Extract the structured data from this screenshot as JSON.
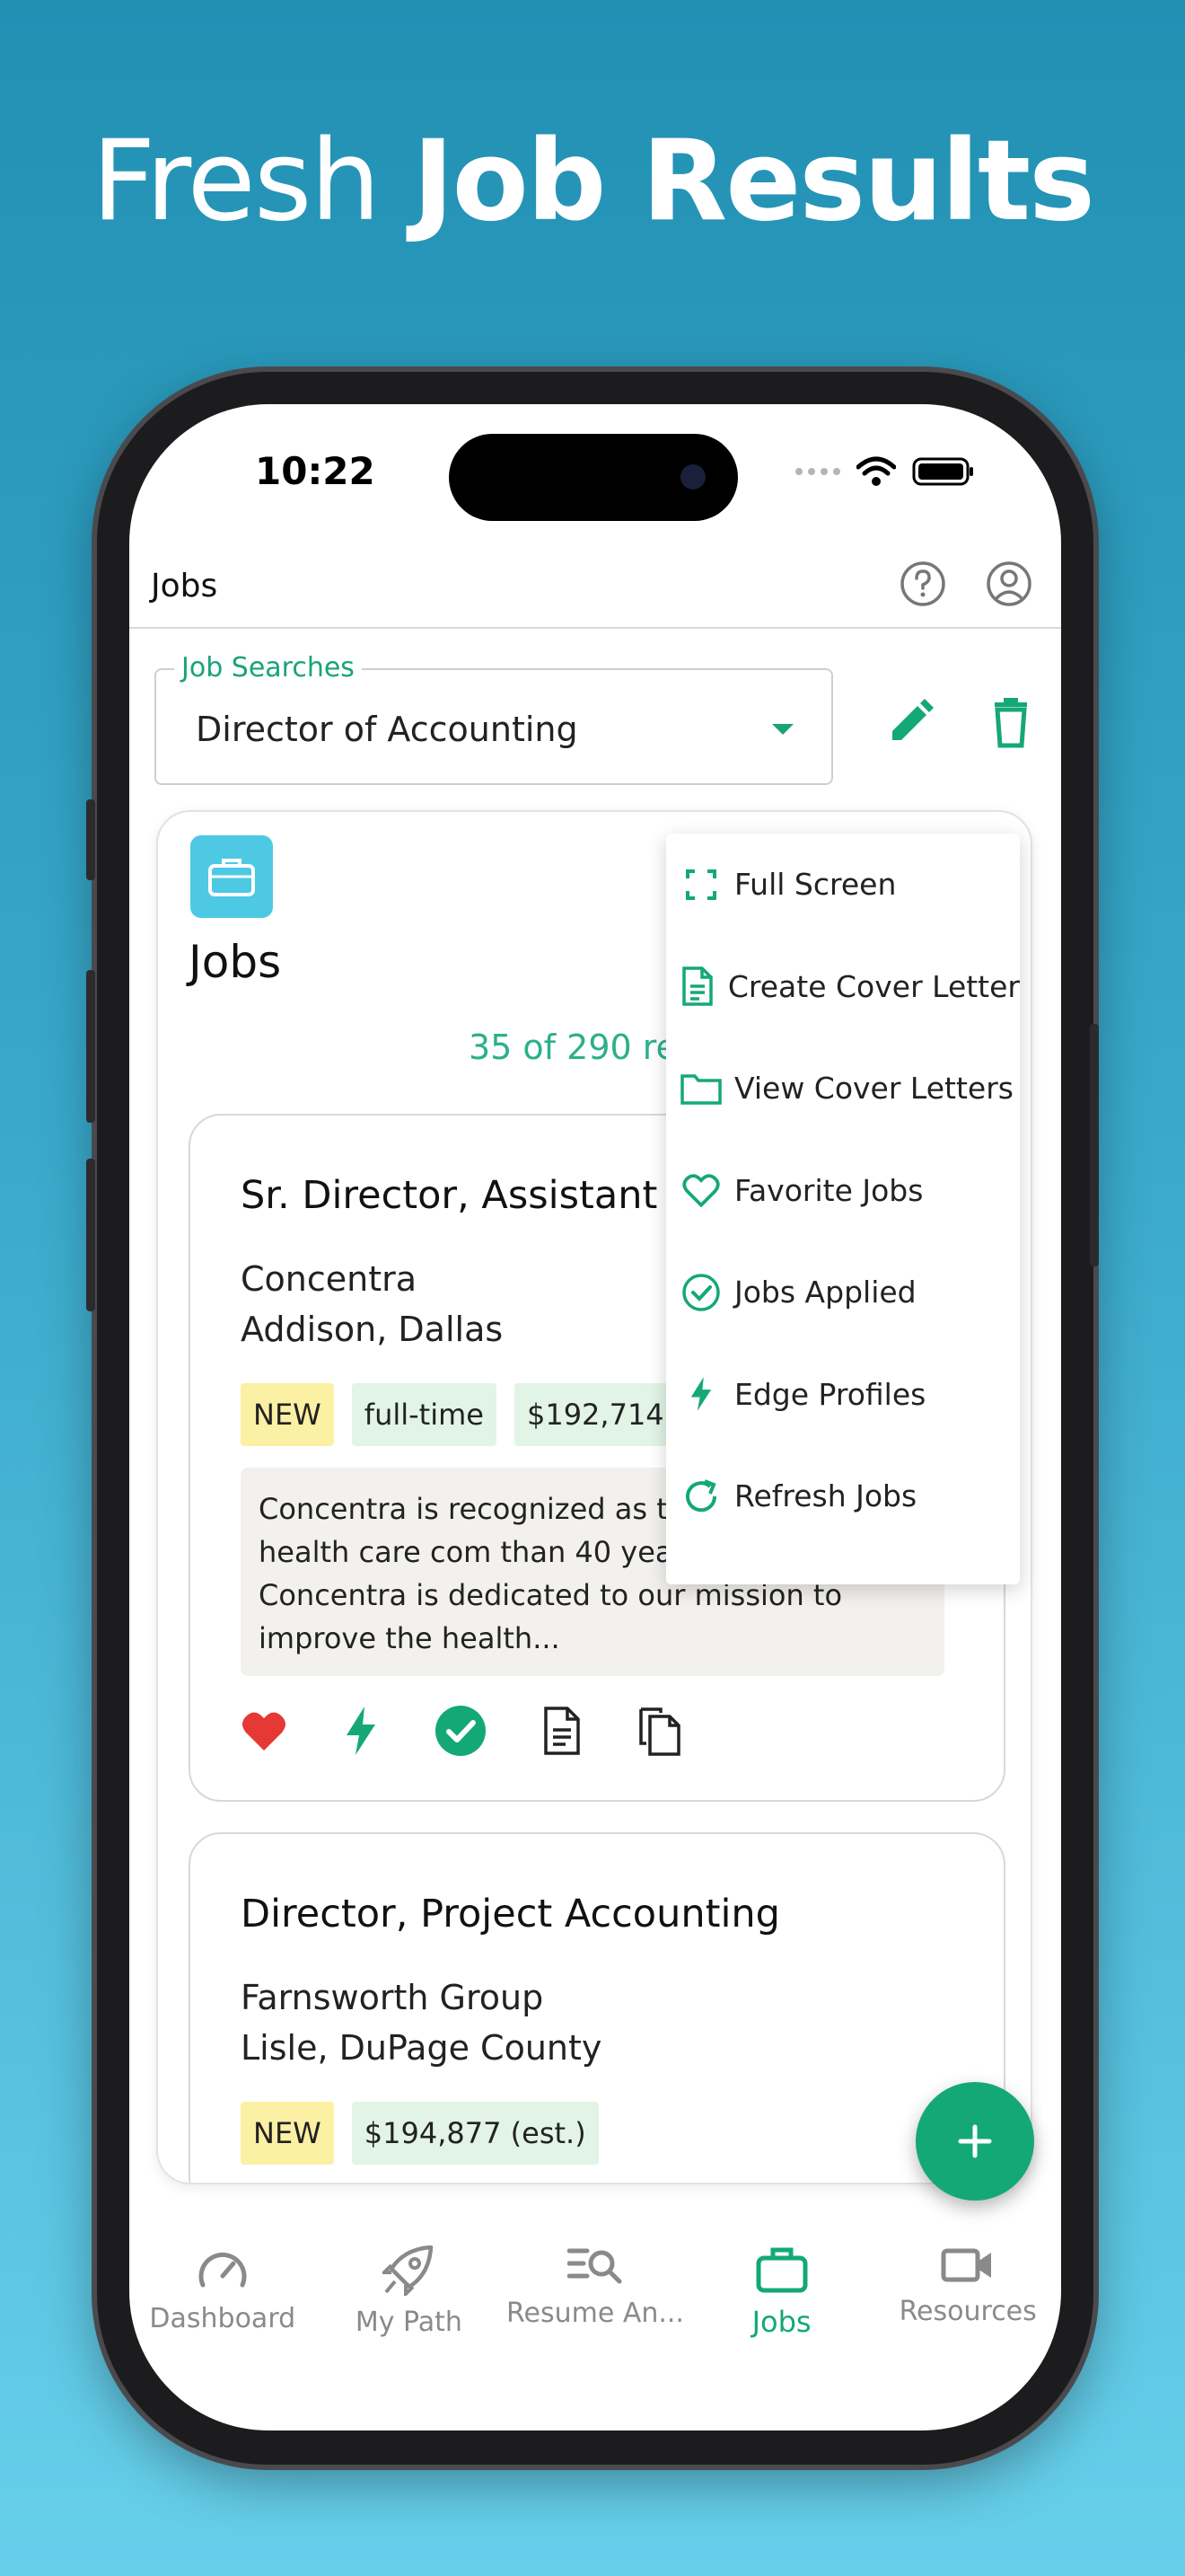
{
  "headline": {
    "light": "Fresh",
    "bold": "Job Results"
  },
  "status_bar": {
    "time": "10:22"
  },
  "app_bar": {
    "title": "Jobs"
  },
  "job_search": {
    "label": "Job Searches",
    "value": "Director of Accounting"
  },
  "jobs_panel": {
    "title": "Jobs",
    "results_text": "35 of 290 res"
  },
  "menu": {
    "items": [
      {
        "label": "Full Screen",
        "icon": "fullscreen-icon"
      },
      {
        "label": "Create Cover Letter",
        "icon": "document-add-icon"
      },
      {
        "label": "View Cover Letters",
        "icon": "folder-icon"
      },
      {
        "label": "Favorite Jobs",
        "icon": "heart-icon"
      },
      {
        "label": "Jobs Applied",
        "icon": "check-circle-icon"
      },
      {
        "label": "Edge Profiles",
        "icon": "lightning-icon"
      },
      {
        "label": "Refresh Jobs",
        "icon": "refresh-icon"
      }
    ]
  },
  "jobs": [
    {
      "title": "Sr. Director, Assistant C",
      "company": "Concentra",
      "location": "Addison, Dallas",
      "chips": [
        "NEW",
        "full-time",
        "$192,714 (es"
      ],
      "description": "Concentra is recognized as th occupational health care com than 40 years of experience, Concentra is dedicated to our mission to improve the health..."
    },
    {
      "title": "Director, Project Accounting",
      "company": "Farnsworth Group",
      "location": "Lisle, DuPage County",
      "chips": [
        "NEW",
        "$194,877 (est.)"
      ]
    }
  ],
  "bottom_nav": {
    "items": [
      {
        "label": "Dashboard",
        "icon": "gauge-icon"
      },
      {
        "label": "My Path",
        "icon": "rocket-icon"
      },
      {
        "label": "Resume An...",
        "icon": "resume-search-icon"
      },
      {
        "label": "Jobs",
        "icon": "briefcase-icon",
        "active": true
      },
      {
        "label": "Resources",
        "icon": "video-camera-icon"
      }
    ]
  },
  "colors": {
    "accent": "#14a877",
    "background_top": "#2190b3",
    "background_bottom": "#67cfea",
    "favorite": "#e53935"
  }
}
